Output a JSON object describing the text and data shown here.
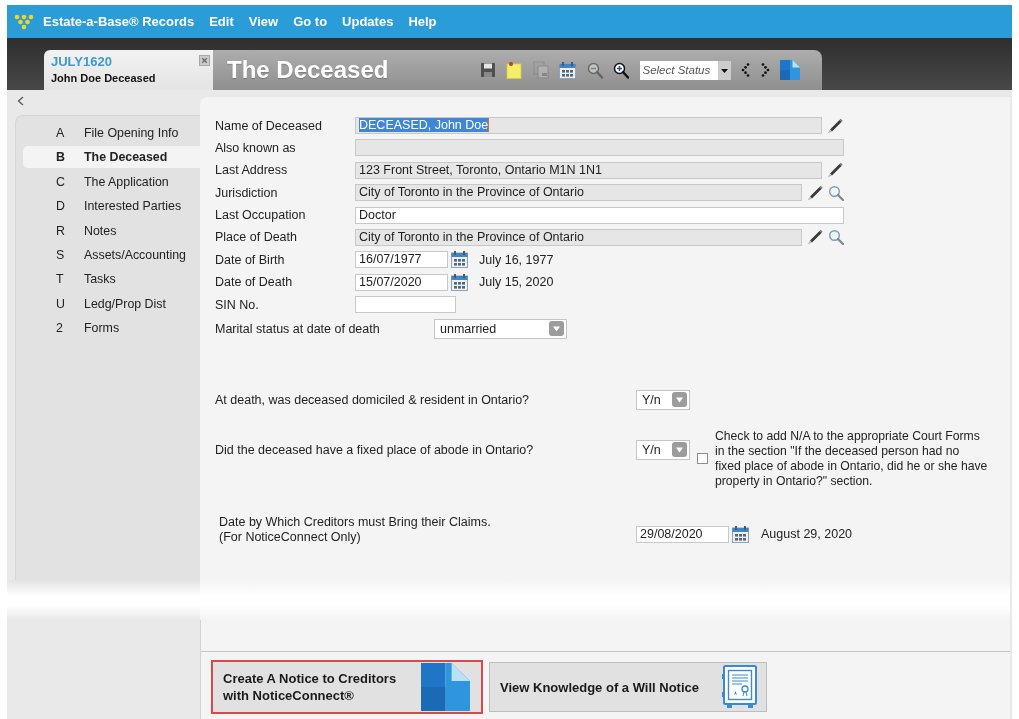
{
  "menu_bar": {
    "items": [
      "Estate-a-Base® Records",
      "Edit",
      "View",
      "Go to",
      "Updates",
      "Help"
    ]
  },
  "record_tab": {
    "code": "JULY1620",
    "name": "John Doe Deceased"
  },
  "title_bar": {
    "title": "The Deceased",
    "tools": [
      {
        "kind": "save",
        "disabled": false
      },
      {
        "kind": "note",
        "disabled": false
      },
      {
        "kind": "copy",
        "disabled": true
      },
      {
        "kind": "calendar",
        "disabled": false
      },
      {
        "kind": "zoom_out",
        "disabled": true
      },
      {
        "kind": "zoom_in",
        "disabled": false
      },
      {
        "kind": "status",
        "placeholder": "Select Status",
        "disabled": false
      },
      {
        "kind": "previous",
        "disabled": false
      },
      {
        "kind": "next",
        "disabled": false
      },
      {
        "kind": "document",
        "disabled": false
      }
    ]
  },
  "sidebar": {
    "items": [
      {
        "key": "A",
        "label": "File Opening Info",
        "selected": false
      },
      {
        "key": "B",
        "label": "The Deceased",
        "selected": true
      },
      {
        "key": "C",
        "label": "The Application",
        "selected": false
      },
      {
        "key": "D",
        "label": "Interested Parties",
        "selected": false
      },
      {
        "key": "R",
        "label": "Notes",
        "selected": false
      },
      {
        "key": "S",
        "label": "Assets/Accounting",
        "selected": false
      },
      {
        "key": "T",
        "label": "Tasks",
        "selected": false
      },
      {
        "key": "U",
        "label": "Ledg/Prop Dist",
        "selected": false
      },
      {
        "key": "2",
        "label": "Forms",
        "selected": false
      }
    ]
  },
  "form": {
    "fields": [
      {
        "kind": "text",
        "label": "Name of Deceased",
        "value": "DECEASED, John Doe",
        "readonly": true,
        "text_selected": true,
        "buttons": [
          {
            "kind": "edit"
          }
        ]
      },
      {
        "kind": "text",
        "label": "Also known as",
        "readonly": true
      },
      {
        "kind": "text",
        "label": "Last Address",
        "value": "123 Front Street, Toronto, Ontario M1N 1N1",
        "readonly": true,
        "text_selected": false,
        "buttons": [
          {
            "kind": "edit"
          }
        ]
      },
      {
        "kind": "text",
        "label": "Jurisdiction",
        "value": "City of Toronto in the Province of Ontario",
        "readonly": true,
        "text_selected": false,
        "buttons": [
          {
            "kind": "edit"
          },
          {
            "kind": "search"
          }
        ]
      },
      {
        "kind": "text",
        "label": "Last Occupation",
        "value": "Doctor",
        "readonly": false,
        "text_selected": false
      },
      {
        "kind": "text",
        "label": "Place of Death",
        "value": "City of Toronto in the Province of Ontario",
        "readonly": true,
        "text_selected": false,
        "buttons": [
          {
            "kind": "edit"
          },
          {
            "kind": "search"
          }
        ]
      },
      {
        "kind": "date",
        "label": "Date of Birth",
        "value": "16/07/1977",
        "long_date": "July 16, 1977",
        "readonly": false,
        "text_selected": false
      },
      {
        "kind": "date",
        "label": "Date of Death",
        "value": "15/07/2020",
        "long_date": "July 15, 2020",
        "readonly": false,
        "text_selected": false
      },
      {
        "kind": "short_text",
        "label": "SIN No.",
        "readonly": false
      },
      {
        "kind": "select",
        "label": "Marital status at date of death",
        "value": "unmarried",
        "readonly": false,
        "text_selected": false
      }
    ]
  },
  "questions": [
    {
      "label": "At death, was deceased domiciled & resident in Ontario?",
      "answer": "Y/n"
    },
    {
      "label": "Did the deceased have a fixed place of abode in Ontario?",
      "answer": "Y/n",
      "checkbox": {
        "checked": false,
        "note_lines": [
          "Check to add N/A to the appropriate Court Forms",
          "in the section \"If the deceased person had no",
          "fixed place of abode in Ontario, did he or she have",
          "property in Ontario?\" section."
        ]
      }
    }
  ],
  "creditors_claim": {
    "label_lines": [
      "Date by Which Creditors must Bring their Claims.",
      "(For NoticeConnect Only)"
    ],
    "value": "29/08/2020",
    "long_date": "August 29, 2020"
  },
  "action_buttons": [
    {
      "kind": "notice",
      "label_lines": [
        "Create A Notice to Creditors",
        "with NoticeConnect®"
      ],
      "highlighted": true
    },
    {
      "kind": "will",
      "label_lines": [
        "View Knowledge of a Will Notice"
      ],
      "highlighted": false
    }
  ]
}
